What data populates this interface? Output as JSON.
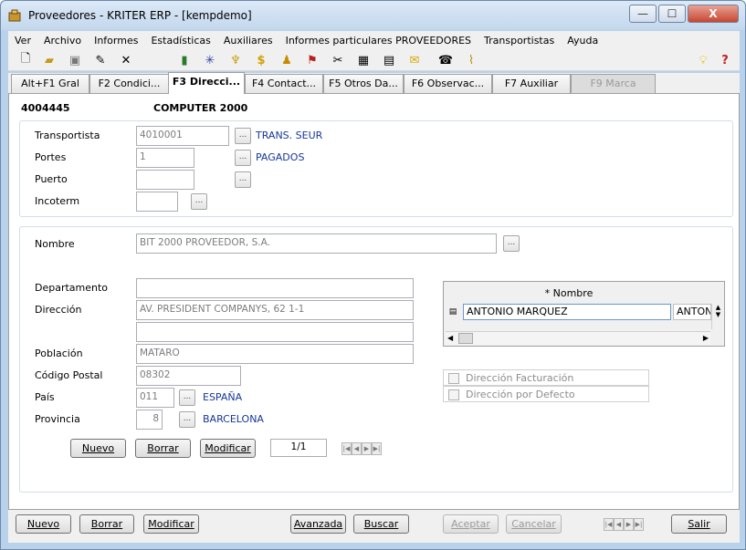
{
  "window": {
    "title": "Proveedores - KRITER ERP - [kempdemo]",
    "minimize": "—",
    "maximize": "☐",
    "close": "X"
  },
  "menu": [
    "Ver",
    "Archivo",
    "Informes",
    "Estadísticas",
    "Auxiliares",
    "Informes particulares PROVEEDORES",
    "Transportistas",
    "Ayuda"
  ],
  "tabs": [
    "Alt+F1 Gral",
    "F2 Condici...",
    "F3 Direcci...",
    "F4 Contact...",
    "F5 Otros Da...",
    "F6 Observac...",
    "F7 Auxiliar",
    "F9 Marca"
  ],
  "supplier": {
    "code": "4004445",
    "name": "COMPUTER 2000"
  },
  "transport": {
    "transportista_label": "Transportista",
    "transportista_value": "4010001",
    "transportista_name": "TRANS. SEUR",
    "portes_label": "Portes",
    "portes_value": "1",
    "portes_name": "PAGADOS",
    "puerto_label": "Puerto",
    "puerto_value": "",
    "incoterm_label": "Incoterm",
    "incoterm_value": ""
  },
  "address": {
    "nombre_label": "Nombre",
    "nombre_value": "BIT 2000 PROVEEDOR, S.A.",
    "departamento_label": "Departamento",
    "departamento_value": "",
    "direccion_label": "Dirección",
    "direccion_value": "AV. PRESIDENT COMPANYS, 62 1-1",
    "direccion2_value": "",
    "poblacion_label": "Población",
    "poblacion_value": "MATARO",
    "cp_label": "Código Postal",
    "cp_value": "08302",
    "pais_label": "País",
    "pais_value": "011",
    "pais_name": "ESPAÑA",
    "provincia_label": "Provincia",
    "provincia_value": "8",
    "provincia_name": "BARCELONA"
  },
  "contacts_grid": {
    "header": "* Nombre",
    "rows": [
      {
        "name": "ANTONIO MARQUEZ",
        "next": "ANTON"
      }
    ]
  },
  "checks": {
    "facturacion": "Dirección Facturación",
    "defecto": "Dirección por Defecto"
  },
  "addr_buttons": {
    "nuevo": "Nuevo",
    "borrar": "Borrar",
    "modificar": "Modificar",
    "pager": "1/1"
  },
  "bottom_buttons": {
    "nuevo": "Nuevo",
    "borrar": "Borrar",
    "modificar": "Modificar",
    "avanzada": "Avanzada",
    "buscar": "Buscar",
    "aceptar": "Aceptar",
    "cancelar": "Cancelar",
    "salir": "Salir"
  },
  "icons": [
    "new-document-icon",
    "open-folder-icon",
    "save-icon",
    "edit-icon",
    "delete-icon",
    "book-icon",
    "asterisk-icon",
    "trophy-icon",
    "dollar-icon",
    "stamp-icon",
    "chart-icon",
    "tools-icon",
    "table-icon",
    "report-icon",
    "mail-icon",
    "phone-icon",
    "paperclip-icon",
    "bulb-icon",
    "help-icon"
  ]
}
